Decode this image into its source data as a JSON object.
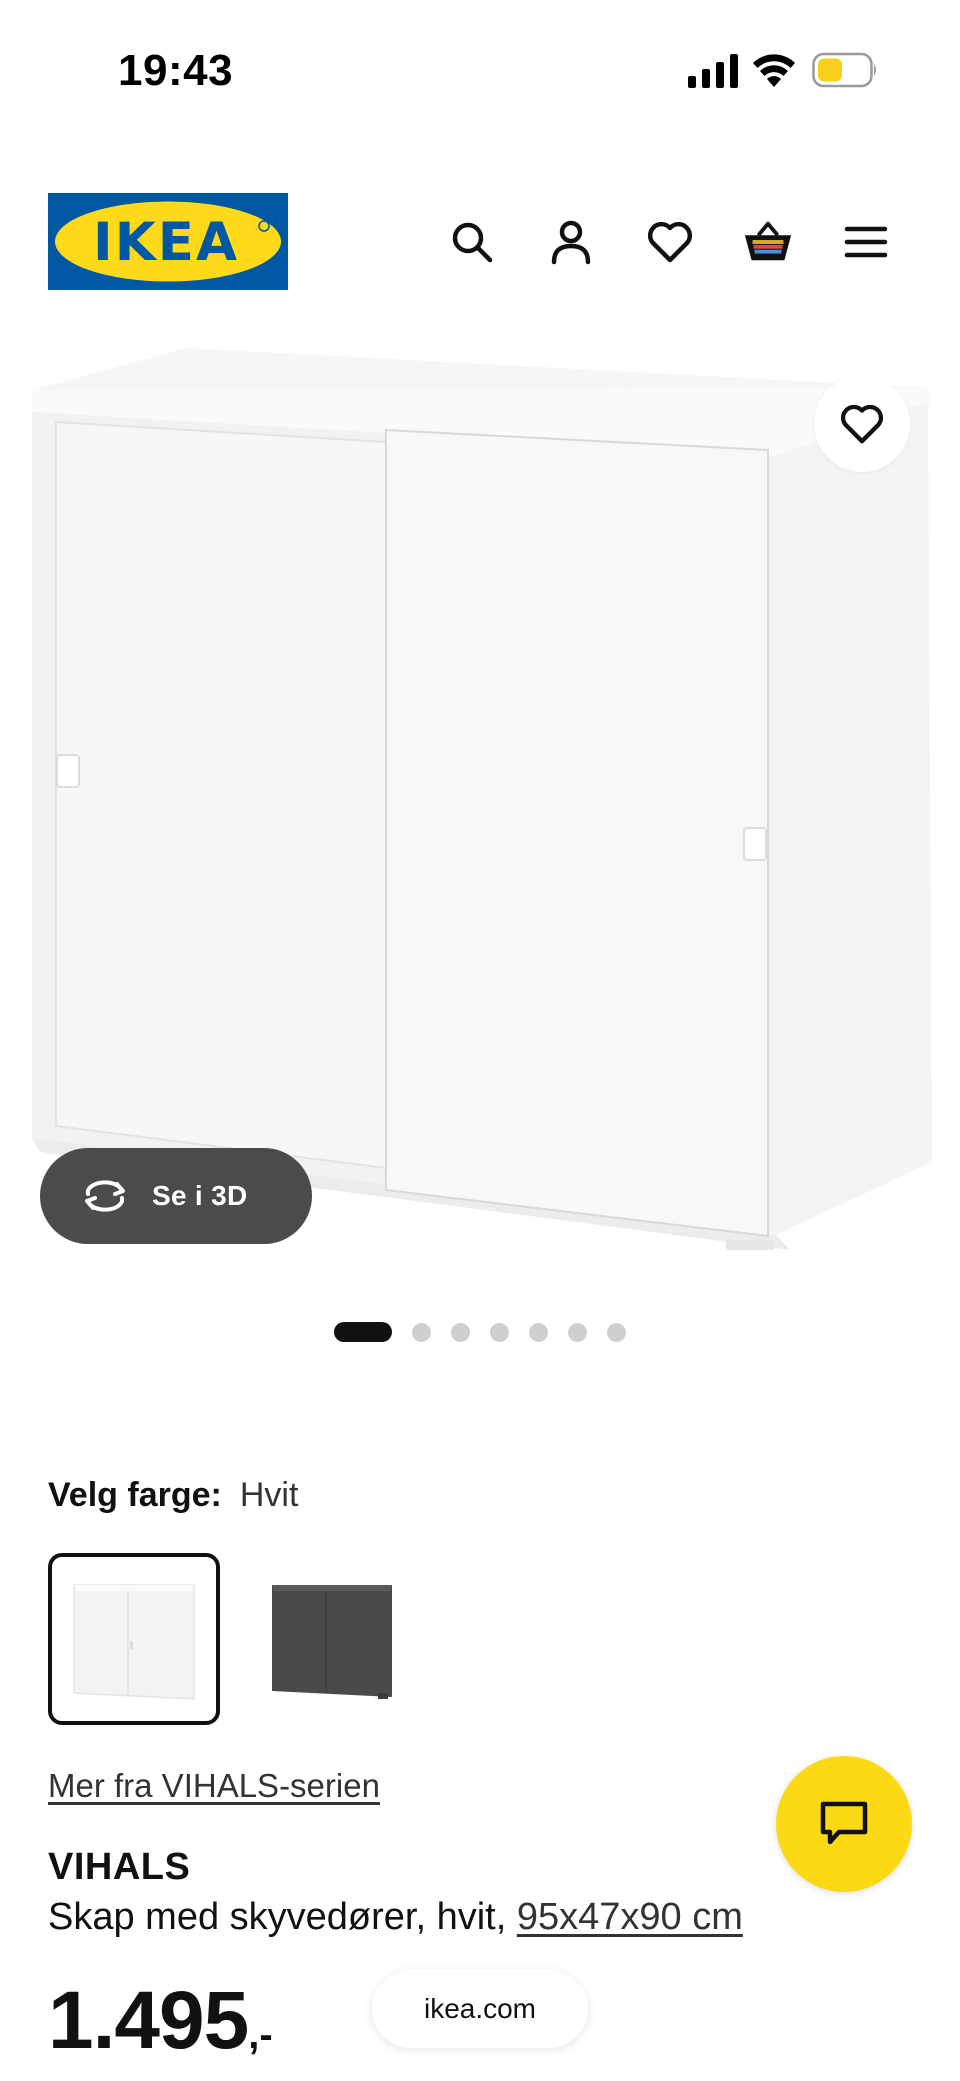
{
  "status_bar": {
    "time": "19:43",
    "icons": [
      "signal-icon",
      "wifi-icon",
      "battery-icon"
    ],
    "battery_color": "#f8d01c"
  },
  "header": {
    "logo": {
      "text": "IKEA",
      "bg_color": "#0058a3",
      "fg_color": "#ffda1a"
    },
    "icons": [
      "search-icon",
      "user-icon",
      "heart-icon",
      "basket-icon",
      "menu-icon"
    ]
  },
  "gallery": {
    "view_3d_label": "Se i 3D",
    "image_count": 7,
    "active_index": 0
  },
  "color_picker": {
    "label": "Velg farge:",
    "selected_value": "Hvit",
    "options": [
      {
        "name": "white-swatch",
        "color": "#f4f4f2",
        "selected": true
      },
      {
        "name": "dark-grey-swatch",
        "color": "#4a4b48",
        "selected": false
      }
    ]
  },
  "series_link": "Mer fra VIHALS-serien",
  "product": {
    "name": "VIHALS",
    "description": "Skap med skyvedører, hvit,",
    "dimensions": "95x47x90 cm"
  },
  "price": {
    "integer": "1.495",
    "suffix": ",-"
  },
  "browser": {
    "url": "ikea.com"
  },
  "colors": {
    "accent_yellow": "#fbd914",
    "dark_pill": "#4b4b4b"
  }
}
